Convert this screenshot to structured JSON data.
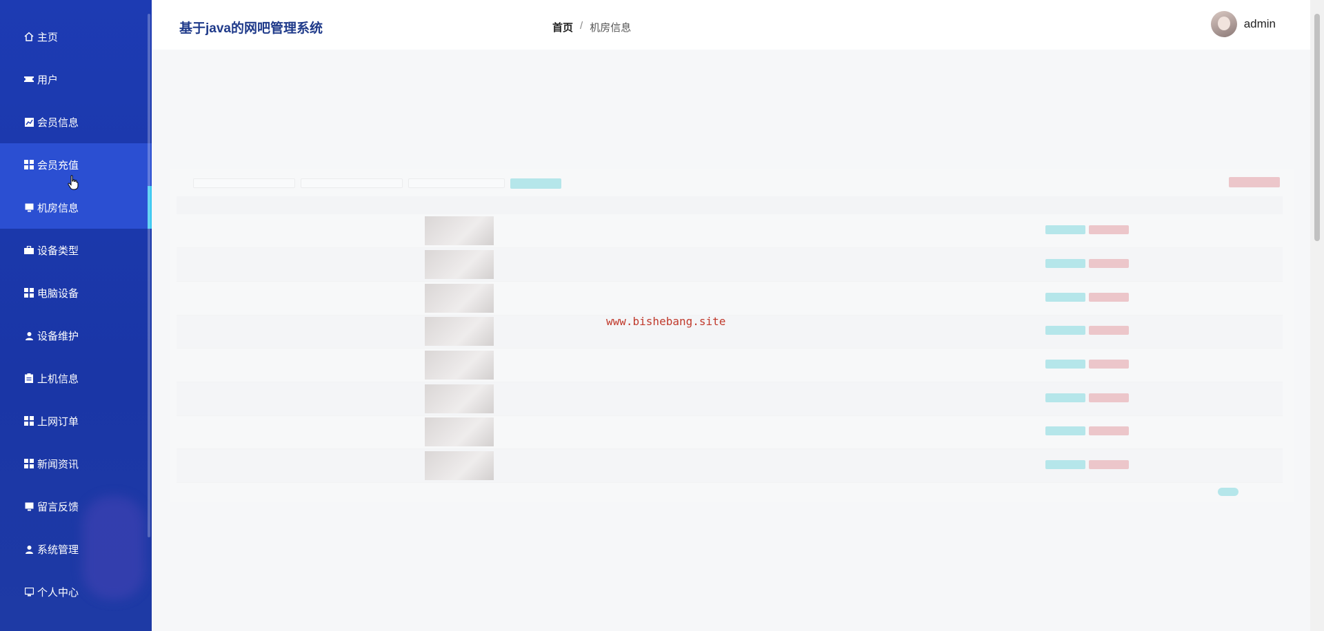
{
  "app": {
    "title": "基于java的网吧管理系统"
  },
  "breadcrumb": {
    "home": "首页",
    "separator": "/",
    "current": "机房信息"
  },
  "user": {
    "name": "admin"
  },
  "sidebar": {
    "items": [
      {
        "label": "主页",
        "icon": "home-icon"
      },
      {
        "label": "用户",
        "icon": "ticket-icon"
      },
      {
        "label": "会员信息",
        "icon": "chart-icon"
      },
      {
        "label": "会员充值",
        "icon": "grid-icon"
      },
      {
        "label": "机房信息",
        "icon": "monitor-icon"
      },
      {
        "label": "设备类型",
        "icon": "briefcase-icon"
      },
      {
        "label": "电脑设备",
        "icon": "grid-icon"
      },
      {
        "label": "设备维护",
        "icon": "user-icon"
      },
      {
        "label": "上机信息",
        "icon": "clipboard-icon"
      },
      {
        "label": "上网订单",
        "icon": "grid-icon"
      },
      {
        "label": "新闻资讯",
        "icon": "grid-icon"
      },
      {
        "label": "留言反馈",
        "icon": "monitor-icon"
      },
      {
        "label": "系统管理",
        "icon": "user-icon"
      },
      {
        "label": "个人中心",
        "icon": "monitor-icon"
      }
    ],
    "active_index": 4,
    "hover_index": 3
  },
  "colors": {
    "sidebar": "#1d3bb3",
    "accent": "#34c6f0",
    "edit": "#5dd0d6",
    "delete": "#e0848a",
    "title": "#1f3a8a"
  },
  "watermark": "www.bishebang.site"
}
